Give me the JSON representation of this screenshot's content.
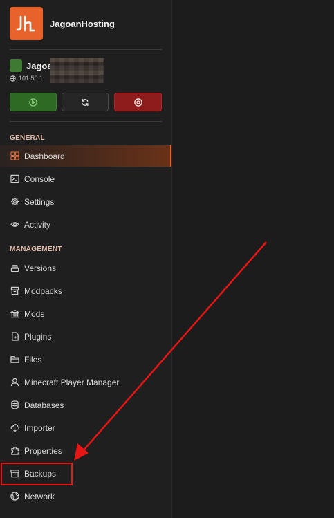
{
  "brand": {
    "name": "JagoanHosting",
    "logo_text": "Jh"
  },
  "server": {
    "name": "Jagoa",
    "ip": "101.50.1."
  },
  "controls": [
    {
      "id": "start",
      "icon": "play-circle-icon"
    },
    {
      "id": "restart",
      "icon": "refresh-icon"
    },
    {
      "id": "stop",
      "icon": "stop-circle-icon"
    }
  ],
  "sections": {
    "general": "GENERAL",
    "management": "MANAGEMENT"
  },
  "nav": {
    "general": [
      {
        "label": "Dashboard",
        "icon": "grid-icon",
        "active": true
      },
      {
        "label": "Console",
        "icon": "terminal-icon"
      },
      {
        "label": "Settings",
        "icon": "gear-icon"
      },
      {
        "label": "Activity",
        "icon": "eye-icon"
      }
    ],
    "management": [
      {
        "label": "Versions",
        "icon": "layers-icon"
      },
      {
        "label": "Modpacks",
        "icon": "package-icon"
      },
      {
        "label": "Mods",
        "icon": "building-icon"
      },
      {
        "label": "Plugins",
        "icon": "file-plus-icon"
      },
      {
        "label": "Files",
        "icon": "folder-icon"
      },
      {
        "label": "Minecraft Player Manager",
        "icon": "user-icon"
      },
      {
        "label": "Databases",
        "icon": "database-icon"
      },
      {
        "label": "Importer",
        "icon": "cloud-download-icon"
      },
      {
        "label": "Properties",
        "icon": "puzzle-icon"
      },
      {
        "label": "Backups",
        "icon": "archive-icon",
        "highlighted": true
      },
      {
        "label": "Network",
        "icon": "globe-icon"
      }
    ]
  },
  "colors": {
    "accent": "#e8622c",
    "start": "#2f6a25",
    "stop": "#8f1c1c",
    "annotation": "#e81515"
  }
}
